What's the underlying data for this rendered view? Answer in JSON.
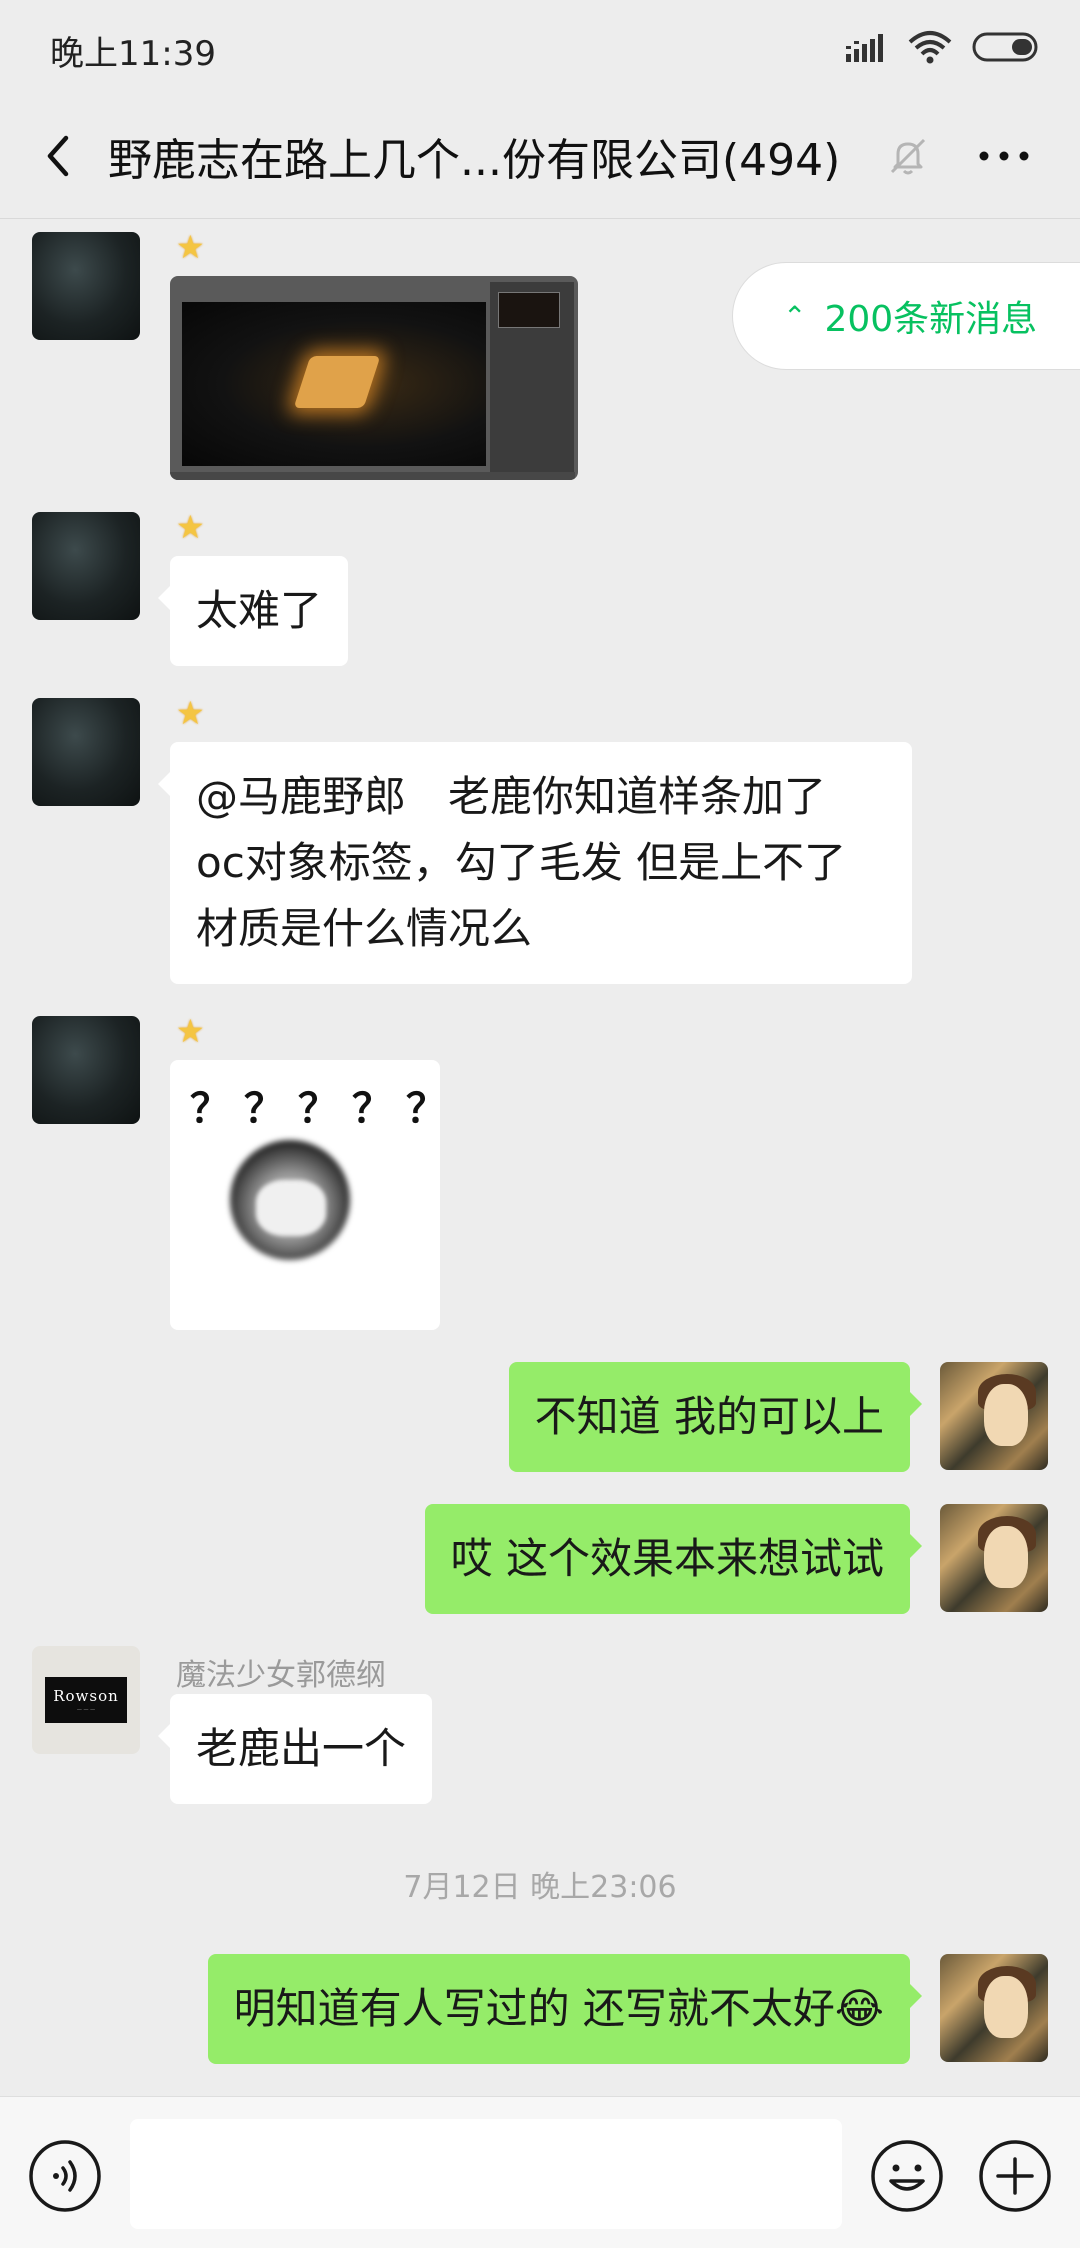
{
  "status_bar": {
    "time": "晚上11:39",
    "icons": [
      "signal-icon",
      "wifi-icon",
      "battery-icon"
    ]
  },
  "header": {
    "title": "野鹿志在路上几个...份有限公司(494)",
    "icons": [
      "back-arrow-icon",
      "mute-bell-icon",
      "more-icon"
    ]
  },
  "new_messages_pill": {
    "label": "200条新消息",
    "color": "#07c160"
  },
  "messages": [
    {
      "side": "left",
      "type": "image",
      "badge": "star-badge-icon",
      "content_desc": "screenshot-thumbnail"
    },
    {
      "side": "left",
      "type": "text",
      "badge": "star-badge-icon",
      "text": "太难了"
    },
    {
      "side": "left",
      "type": "text",
      "badge": "star-badge-icon",
      "lines": [
        "@马鹿野郎　老鹿你知道样条加了",
        "oc对象标签，勾了毛发 但是上不了",
        "材质是什么情况么"
      ]
    },
    {
      "side": "left",
      "type": "sticker",
      "badge": "star-badge-icon",
      "sticker_text": "？？？？？？"
    },
    {
      "side": "right",
      "type": "text",
      "text": "不知道 我的可以上"
    },
    {
      "side": "right",
      "type": "text",
      "text": "哎 这个效果本来想试试"
    },
    {
      "side": "left",
      "type": "text",
      "sender": "魔法少女郭德纲",
      "avatar_text": "Rowson",
      "text": "老鹿出一个"
    },
    {
      "side": "right",
      "type": "text",
      "text": "明知道有人写过的 还写就不太好😂"
    }
  ],
  "timestamp": "7月12日 晚上23:06",
  "input_bar": {
    "value": "",
    "icons": [
      "voice-icon",
      "emoji-icon",
      "plus-icon"
    ]
  },
  "colors": {
    "background": "#ededed",
    "sent_bubble": "#95ec69",
    "received_bubble": "#ffffff"
  }
}
